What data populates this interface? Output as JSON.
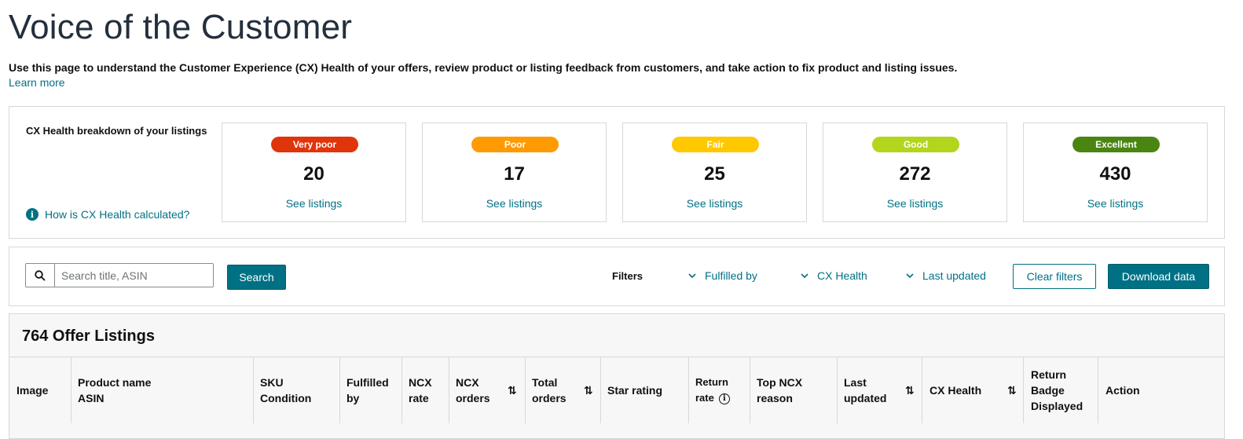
{
  "page": {
    "title": "Voice of the Customer",
    "description": "Use this page to understand the Customer Experience (CX) Health of your offers, review product or listing feedback from customers, and take action to fix product and listing issues.",
    "learn_more": "Learn more"
  },
  "cx": {
    "breakdown_title": "CX Health breakdown of your listings",
    "how_link": "How is CX Health calculated?",
    "info_glyph": "i",
    "cards": [
      {
        "label": "Very poor",
        "count": "20",
        "link": "See listings",
        "color": "#e0340b"
      },
      {
        "label": "Poor",
        "count": "17",
        "link": "See listings",
        "color": "#ff9a03"
      },
      {
        "label": "Fair",
        "count": "25",
        "link": "See listings",
        "color": "#ffc800"
      },
      {
        "label": "Good",
        "count": "272",
        "link": "See listings",
        "color": "#b3d51c"
      },
      {
        "label": "Excellent",
        "count": "430",
        "link": "See listings",
        "color": "#4a8512"
      }
    ]
  },
  "search": {
    "placeholder": "Search title, ASIN",
    "button": "Search"
  },
  "filters": {
    "label": "Filters",
    "dropdowns": [
      "Fulfilled by",
      "CX Health",
      "Last updated"
    ],
    "clear": "Clear filters",
    "download": "Download data"
  },
  "listings": {
    "title": "764 Offer Listings",
    "columns": [
      {
        "lines": [
          "Image"
        ]
      },
      {
        "lines": [
          "Product name",
          "ASIN"
        ]
      },
      {
        "lines": [
          "SKU",
          "Condition"
        ]
      },
      {
        "lines": [
          "Fulfilled",
          "by"
        ]
      },
      {
        "lines": [
          "NCX",
          "rate"
        ]
      },
      {
        "lines": [
          "NCX",
          "orders"
        ]
      },
      {
        "lines": [
          "Total",
          "orders"
        ]
      },
      {
        "lines": [
          "Star rating"
        ]
      },
      {
        "lines": [
          "Return",
          "rate"
        ]
      },
      {
        "lines": [
          "Top NCX",
          "reason"
        ]
      },
      {
        "lines": [
          "Last",
          "updated"
        ]
      },
      {
        "lines": [
          "CX Health"
        ]
      },
      {
        "lines": [
          "Return",
          "Badge",
          "Displayed"
        ]
      },
      {
        "lines": [
          "Action"
        ]
      }
    ],
    "sort_glyph": "⇅",
    "info_glyph": "i"
  },
  "colors": {
    "link": "#007185",
    "primary_button": "#007185",
    "title": "#232f3e"
  }
}
